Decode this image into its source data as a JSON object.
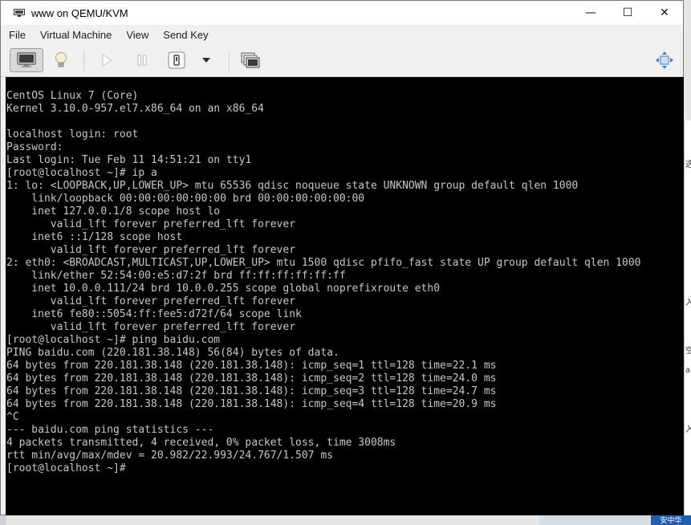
{
  "window": {
    "title": "www on QEMU/KVM",
    "controls": {
      "minimize": "—",
      "maximize": "☐",
      "close": "✕"
    }
  },
  "menu": {
    "items": [
      "File",
      "Virtual Machine",
      "View",
      "Send Key"
    ]
  },
  "toolbar": {
    "buttons": [
      {
        "name": "show-graphical-console",
        "icon": "monitor-icon"
      },
      {
        "name": "show-details",
        "icon": "lightbulb-icon"
      },
      {
        "name": "run",
        "icon": "play-icon"
      },
      {
        "name": "pause",
        "icon": "pause-icon"
      },
      {
        "name": "shutdown",
        "icon": "power-icon"
      },
      {
        "name": "shutdown-menu",
        "icon": "chevron-down-icon"
      },
      {
        "name": "snapshots",
        "icon": "snapshot-icon"
      },
      {
        "name": "fullscreen",
        "icon": "resize-arrows-icon"
      }
    ]
  },
  "console": {
    "lines": [
      "CentOS Linux 7 (Core)",
      "Kernel 3.10.0-957.el7.x86_64 on an x86_64",
      "",
      "localhost login: root",
      "Password:",
      "Last login: Tue Feb 11 14:51:21 on tty1",
      "[root@localhost ~]# ip a",
      "1: lo: <LOOPBACK,UP,LOWER_UP> mtu 65536 qdisc noqueue state UNKNOWN group default qlen 1000",
      "    link/loopback 00:00:00:00:00:00 brd 00:00:00:00:00:00",
      "    inet 127.0.0.1/8 scope host lo",
      "       valid_lft forever preferred_lft forever",
      "    inet6 ::1/128 scope host",
      "       valid_lft forever preferred_lft forever",
      "2: eth0: <BROADCAST,MULTICAST,UP,LOWER_UP> mtu 1500 qdisc pfifo_fast state UP group default qlen 1000",
      "    link/ether 52:54:00:e5:d7:2f brd ff:ff:ff:ff:ff:ff",
      "    inet 10.0.0.111/24 brd 10.0.0.255 scope global noprefixroute eth0",
      "       valid_lft forever preferred_lft forever",
      "    inet6 fe80::5054:ff:fee5:d72f/64 scope link",
      "       valid_lft forever preferred_lft forever",
      "[root@localhost ~]# ping baidu.com",
      "PING baidu.com (220.181.38.148) 56(84) bytes of data.",
      "64 bytes from 220.181.38.148 (220.181.38.148): icmp_seq=1 ttl=128 time=22.1 ms",
      "64 bytes from 220.181.38.148 (220.181.38.148): icmp_seq=2 ttl=128 time=24.0 ms",
      "64 bytes from 220.181.38.148 (220.181.38.148): icmp_seq=3 ttl=128 time=24.7 ms",
      "64 bytes from 220.181.38.148 (220.181.38.148): icmp_seq=4 ttl=128 time=20.9 ms",
      "^C",
      "--- baidu.com ping statistics ---",
      "4 packets transmitted, 4 received, 0% packet loss, time 3008ms",
      "rtt min/avg/max/mdev = 20.982/22.993/24.767/1.507 ms",
      "[root@localhost ~]#"
    ]
  },
  "colors": {
    "console_bg": "#000000",
    "console_fg": "#c8c8c8",
    "toolbar_bg": "#f0f0f0",
    "accent": "#1f5fae"
  },
  "background": {
    "right_fragments": [
      "选",
      "入",
      "空",
      "ar",
      "入"
    ],
    "bottom_label": "安中华"
  }
}
